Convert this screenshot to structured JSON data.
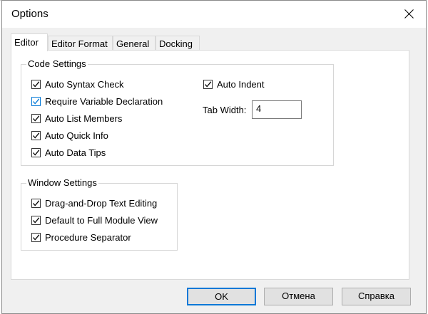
{
  "window": {
    "title": "Options",
    "close_icon": "close-icon"
  },
  "tabs": [
    {
      "label": "Editor",
      "active": true
    },
    {
      "label": "Editor Format",
      "active": false
    },
    {
      "label": "General",
      "active": false
    },
    {
      "label": "Docking",
      "active": false
    }
  ],
  "code_settings": {
    "label": "Code Settings",
    "items": [
      {
        "label": "Auto Syntax Check",
        "checked": true
      },
      {
        "label": "Require Variable Declaration",
        "checked": true
      },
      {
        "label": "Auto List Members",
        "checked": true
      },
      {
        "label": "Auto Quick Info",
        "checked": true
      },
      {
        "label": "Auto Data Tips",
        "checked": true
      }
    ],
    "auto_indent": {
      "label": "Auto Indent",
      "checked": true
    },
    "tab_width": {
      "label": "Tab Width:",
      "value": "4"
    }
  },
  "window_settings": {
    "label": "Window Settings",
    "items": [
      {
        "label": "Drag-and-Drop Text Editing",
        "checked": true
      },
      {
        "label": "Default to Full Module View",
        "checked": true
      },
      {
        "label": "Procedure Separator",
        "checked": true
      }
    ]
  },
  "buttons": {
    "ok": "OK",
    "cancel": "Отмена",
    "help": "Справка"
  },
  "colors": {
    "accent": "#0078d7",
    "dialog_bg": "#f0f0f0",
    "panel_bg": "#ffffff"
  }
}
